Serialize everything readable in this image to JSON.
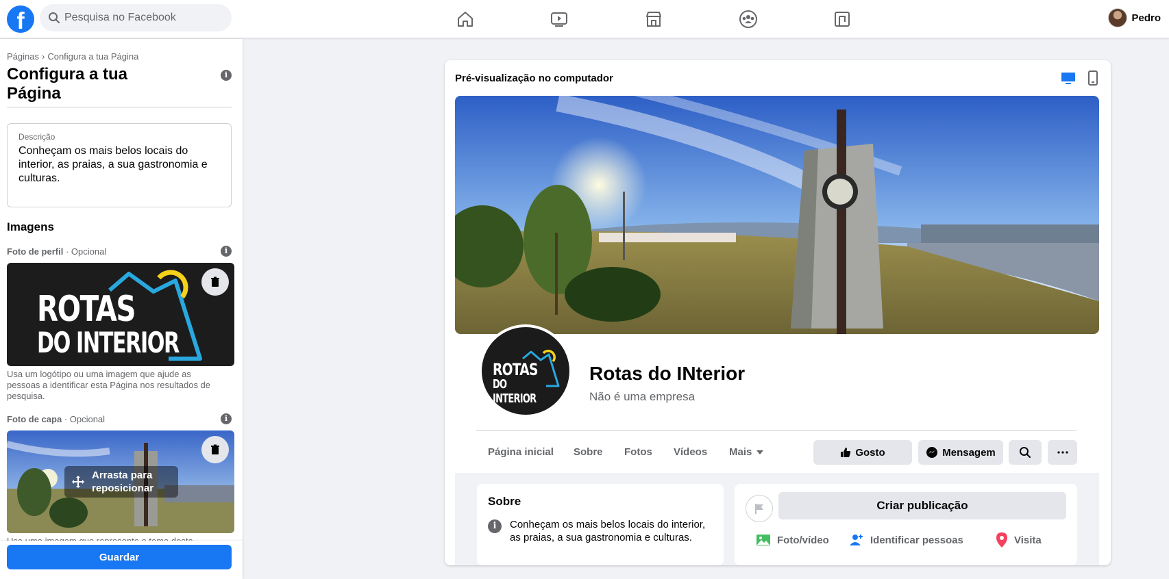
{
  "topbar": {
    "logo": "f",
    "search_placeholder": "Pesquisa no Facebook",
    "nav_icons": [
      "home-icon",
      "watch-icon",
      "marketplace-icon",
      "groups-icon",
      "gaming-icon"
    ],
    "user_name": "Pedro"
  },
  "sidebar": {
    "breadcrumb": [
      "Páginas",
      "Configura a tua Página"
    ],
    "breadcrumb_sep": "›",
    "title": "Configura a tua Página",
    "description_label": "Descrição",
    "description_value": "Conheçam os mais belos locais do interior, as praias, a sua gastronomia e culturas.",
    "images_heading": "Imagens",
    "profile_photo": {
      "label": "Foto de perfil",
      "optional": " · Opcional",
      "logo_line1": "ROTAS",
      "logo_line2": "DO INTERIOR",
      "help": "Usa um logótipo ou uma imagem que ajude as pessoas a identificar esta Página nos resultados de pesquisa."
    },
    "cover_photo": {
      "label": "Foto de capa",
      "optional": " · Opcional",
      "drag_hint": "Arrasta para reposicionar",
      "help": "Usa uma imagem que represente o tema desta"
    },
    "save_label": "Guardar"
  },
  "preview": {
    "title": "Pré-visualização no computador",
    "device_icons": [
      "desktop-icon",
      "mobile-icon"
    ],
    "page_name": "Rotas do INterior",
    "page_subtitle": "Não é uma empresa",
    "logo_line1": "ROTAS",
    "logo_line2": "DO INTERIOR",
    "tabs": [
      "Página inicial",
      "Sobre",
      "Fotos",
      "Vídeos",
      "Mais"
    ],
    "actions": {
      "like": "Gosto",
      "message": "Mensagem"
    },
    "about": {
      "heading": "Sobre",
      "text": "Conheçam os mais belos locais do interior, as praias, a sua gastronomia e culturas."
    },
    "create_post": "Criar publicação",
    "post_actions": [
      "Foto/vídeo",
      "Identificar pessoas",
      "Visita"
    ]
  },
  "colors": {
    "brand": "#1877f2",
    "logo_blue": "#29a8e0",
    "logo_yellow": "#f4d21a",
    "checkin_red": "#f3425f",
    "photo_green": "#45bd62"
  }
}
